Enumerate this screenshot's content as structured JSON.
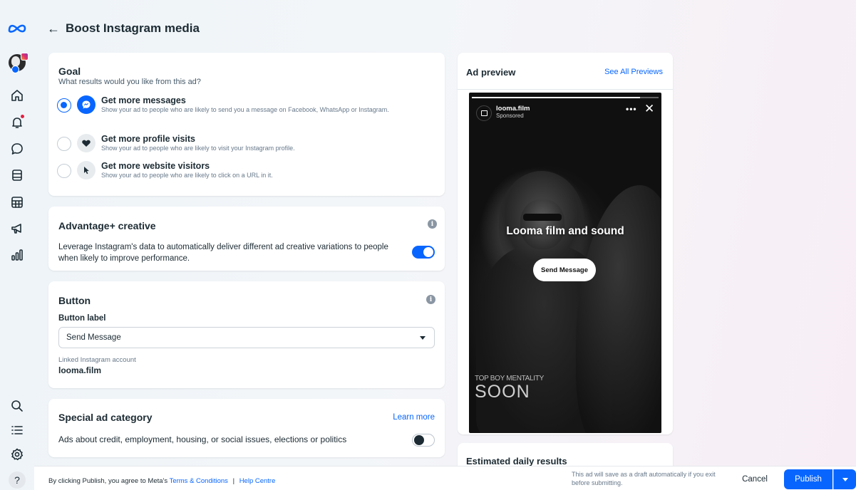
{
  "header": {
    "back": "←",
    "title": "Boost Instagram media"
  },
  "goal": {
    "title": "Goal",
    "question": "What results would you like from this ad?",
    "options": [
      {
        "label": "Get more messages",
        "desc": "Show your ad to people who are likely to send you a message on Facebook, WhatsApp or Instagram.",
        "selected": true
      },
      {
        "label": "Get more profile visits",
        "desc": "Show your ad to people who are likely to visit your Instagram profile.",
        "selected": false
      },
      {
        "label": "Get more website visitors",
        "desc": "Show your ad to people who are likely to click on a URL in it.",
        "selected": false
      }
    ]
  },
  "advantage": {
    "title": "Advantage+ creative",
    "desc": "Leverage Instagram's data to automatically deliver different ad creative variations to people when likely to improve performance.",
    "enabled": true
  },
  "button_card": {
    "title": "Button",
    "field_label": "Button label",
    "selected_value": "Send Message",
    "linked_label": "Linked Instagram account",
    "linked_value": "looma.film"
  },
  "special": {
    "title": "Special ad category",
    "learn_more": "Learn more",
    "desc": "Ads about credit, employment, housing, or social issues, elections or politics",
    "enabled": false
  },
  "preview": {
    "title": "Ad preview",
    "see_all": "See All Previews",
    "account": "looma.film",
    "sponsored": "Sponsored",
    "more": "•••",
    "close": "✕",
    "headline": "Looma film and sound",
    "cta": "Send Message",
    "tagline": "TOP BOY MENTALITY",
    "big_text": "SOON",
    "story_progress": 0.9
  },
  "estimated": {
    "title": "Estimated daily results"
  },
  "footer": {
    "legal_prefix": "By clicking Publish, you agree to Meta's",
    "terms": "Terms & Conditions",
    "separator": "|",
    "help": "Help Centre",
    "draft_note": "This ad will save as a draft automatically if you exit before submitting.",
    "cancel": "Cancel",
    "publish": "Publish"
  },
  "help_glyph": "?",
  "colors": {
    "accent": "#0866ff",
    "text": "#1c2b33",
    "notification": "#e41e3f"
  },
  "rail_icons": [
    "meta-logo-icon",
    "account-avatar",
    "home-icon",
    "notifications-icon",
    "messages-icon",
    "content-icon",
    "planner-icon",
    "ads-icon",
    "insights-icon",
    "search-icon",
    "menu-icon",
    "settings-icon",
    "help-icon"
  ]
}
